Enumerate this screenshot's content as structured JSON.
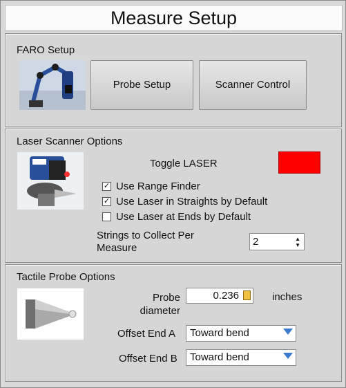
{
  "window": {
    "title": "Measure Setup"
  },
  "faro": {
    "title": "FARO Setup",
    "probe_setup_label": "Probe Setup",
    "scanner_control_label": "Scanner Control"
  },
  "laser": {
    "title": "Laser Scanner Options",
    "toggle_label": "Toggle LASER",
    "laser_indicator_color": "#ff0000",
    "use_range_finder": {
      "label": "Use Range Finder",
      "checked": true
    },
    "use_laser_straights": {
      "label": "Use Laser in Straights by Default",
      "checked": true
    },
    "use_laser_ends": {
      "label": "Use Laser at Ends by Default",
      "checked": false
    },
    "strings_label_line1": "Strings to Collect Per",
    "strings_label_line2": "Measure",
    "strings_value": "2"
  },
  "tactile": {
    "title": "Tactile Probe Options",
    "probe_label_line1": "Probe",
    "probe_label_line2": "diameter",
    "probe_value": "0.236",
    "probe_units": "inches",
    "offset_a_label": "Offset End A",
    "offset_a_value": "Toward bend",
    "offset_b_label": "Offset End B",
    "offset_b_value": "Toward bend"
  },
  "icons": [
    "faro-arm-image",
    "laser-scanner-image",
    "probe-tip-image",
    "calculator-icon",
    "spinner-up-icon",
    "spinner-down-icon",
    "dropdown-arrow-icon"
  ]
}
